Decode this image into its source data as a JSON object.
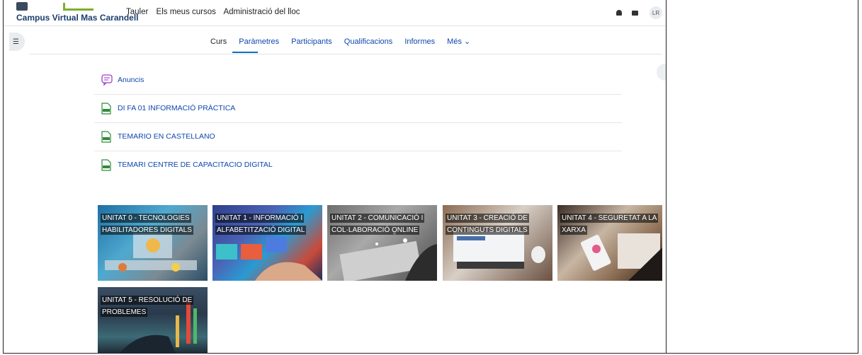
{
  "header": {
    "brand": "Campus Virtual Mas Carandell",
    "nav": [
      "Tauler",
      "Els meus cursos",
      "Administració del lloc"
    ],
    "user_initials": "LR"
  },
  "course_nav": {
    "items": [
      "Curs",
      "Paràmetres",
      "Participants",
      "Qualificacions",
      "Informes",
      "Més ⌄"
    ],
    "active": "Curs"
  },
  "activities": [
    {
      "label": "Anuncis",
      "icon": "forum-icon"
    },
    {
      "label": "DI FA 01 INFORMACIÓ PRÀCTICA",
      "icon": "pdf-icon"
    },
    {
      "label": "TEMARIO EN CASTELLANO",
      "icon": "pdf-icon"
    },
    {
      "label": "TEMARI CENTRE DE CAPACITACIO DIGITAL",
      "icon": "pdf-icon"
    }
  ],
  "units": [
    {
      "title": "UNITAT 0 - TECNOLOGIES HABILITADORES DIGITALS"
    },
    {
      "title": "UNITAT 1 - INFORMACIÓ I ALFABETITZACIÓ DIGITAL"
    },
    {
      "title": "UNITAT 2 - COMUNICACIÓ I COL·LABORACIÓ ONLINE"
    },
    {
      "title": "UNITAT 3 - CREACIÓ DE CONTINGUTS DIGITALS"
    },
    {
      "title": "UNITAT 4 - SEGURETAT A LA XARXA"
    },
    {
      "title": "UNITAT 5 - RESOLUCIÓ DE PROBLEMES"
    }
  ],
  "colors": {
    "link": "#0f47ad",
    "accent": "#0f6cbf",
    "forum_icon": "#a33fcf",
    "pdf_icon": "#2e8c3a"
  }
}
